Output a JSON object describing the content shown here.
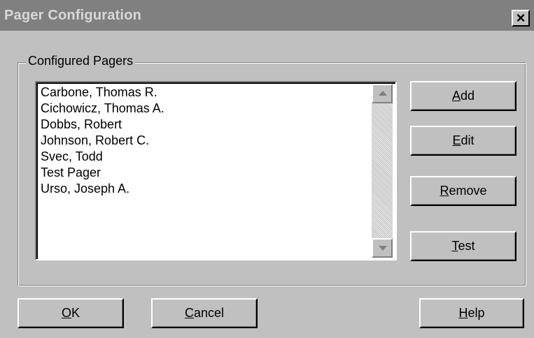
{
  "window": {
    "title": "Pager Configuration",
    "close_label": "×"
  },
  "group": {
    "label": "Configured Pagers"
  },
  "pagers": [
    "Carbone, Thomas R.",
    "Cichowicz, Thomas A.",
    "Dobbs, Robert",
    "Johnson, Robert C.",
    "Svec, Todd",
    "Test Pager",
    "Urso, Joseph A."
  ],
  "buttons": {
    "add": "Add",
    "edit": "Edit",
    "remove": "Remove",
    "test": "Test",
    "ok": "OK",
    "cancel": "Cancel",
    "help": "Help"
  },
  "icons": {
    "close": "close-icon",
    "scroll_up": "scroll-up-arrow-icon",
    "scroll_down": "scroll-down-arrow-icon"
  },
  "colors": {
    "title_bar": "#808080",
    "face": "#c0c0c0"
  }
}
